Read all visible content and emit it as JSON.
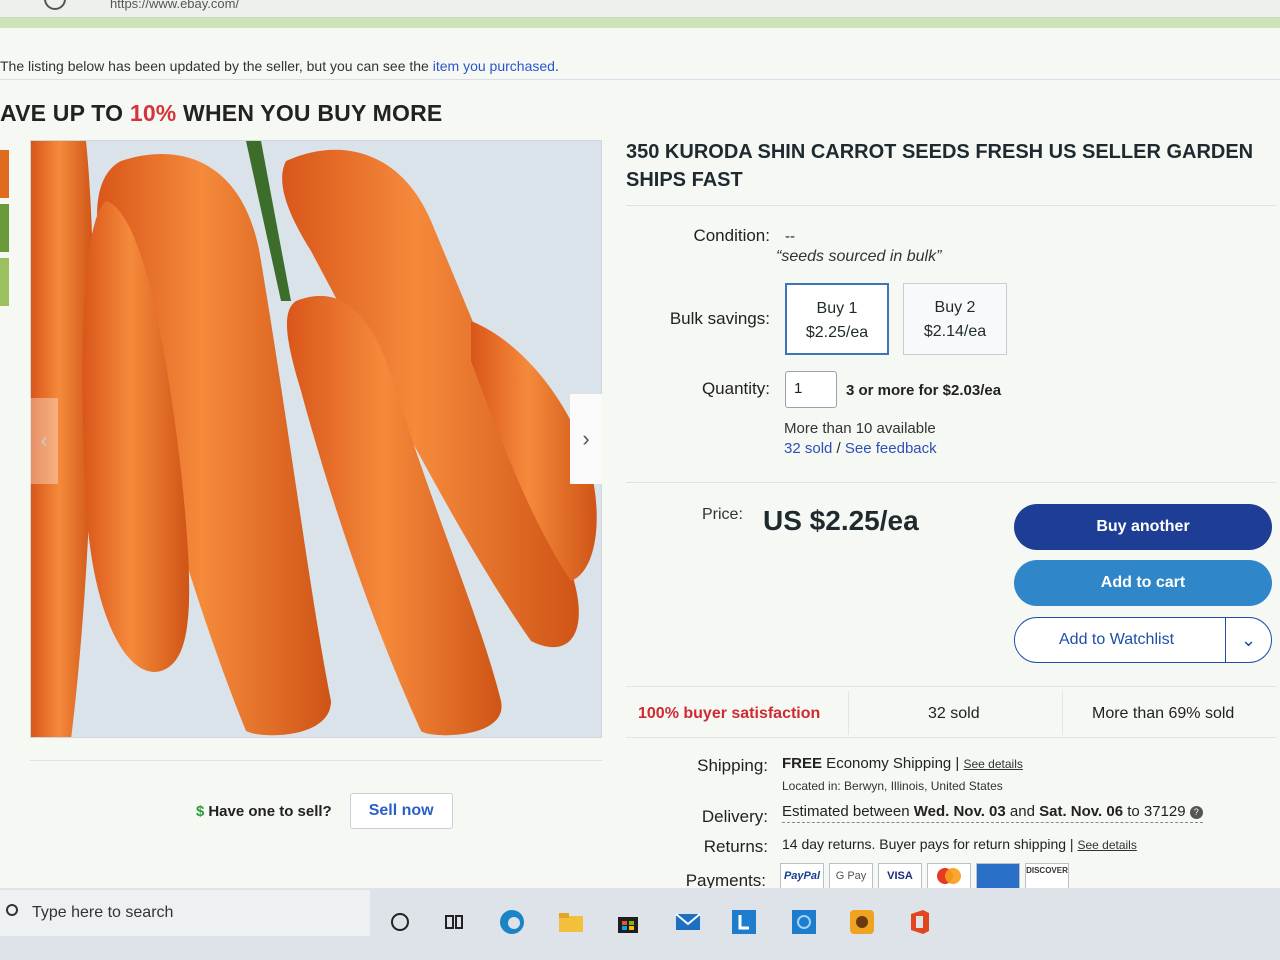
{
  "browser": {
    "url": "https://www.ebay.com/"
  },
  "notice": {
    "prefix": "The listing below has been updated by the seller, but you can see the ",
    "link": "item you purchased",
    "suffix": "."
  },
  "promo": {
    "lead": "AVE UP TO ",
    "pct": "10%",
    "tail": " WHEN YOU BUY MORE"
  },
  "sell": {
    "question": "Have one to sell?",
    "button": "Sell now",
    "dollar": "$"
  },
  "listing": {
    "title": "350 KURODA SHIN CARROT SEEDS FRESH US SELLER GARDEN SHIPS FAST",
    "condition_label": "Condition:",
    "condition_value": "--",
    "quote": "seeds sourced in bulk",
    "bulk_label": "Bulk savings:",
    "bulk": [
      {
        "qty": "Buy 1",
        "price": "$2.25/ea"
      },
      {
        "qty": "Buy 2",
        "price": "$2.14/ea"
      }
    ],
    "quantity_label": "Quantity:",
    "quantity_value": "1",
    "quantity_note": "3 or more for $2.03/ea",
    "available": "More than 10 available",
    "sold_link": "32 sold",
    "slash": " / ",
    "feedback_link": "See feedback",
    "price_label": "Price:",
    "price": "US $2.25/ea",
    "buy_another": "Buy another",
    "add_to_cart": "Add to cart",
    "add_to_watchlist": "Add to Watchlist",
    "stats": {
      "satisfaction": "100% buyer satisfaction",
      "sold": "32 sold",
      "percent_sold": "More than 69% sold"
    },
    "shipping_label": "Shipping:",
    "shipping_free": "FREE",
    "shipping_method": " Economy Shipping | ",
    "shipping_details": "See details",
    "location": "Located in: Berwyn, Illinois, United States",
    "delivery_label": "Delivery:",
    "delivery_prefix": "Estimated between ",
    "delivery_start": "Wed. Nov. 03",
    "delivery_and": " and ",
    "delivery_end": "Sat. Nov. 06",
    "delivery_to": " to 37129 ",
    "returns_label": "Returns:",
    "returns_text": "14 day returns. Buyer pays for return shipping | ",
    "returns_details": "See details",
    "payments_label": "Payments:",
    "payments": [
      "PayPal",
      "G Pay",
      "VISA",
      "Mastercard",
      "AMEX",
      "DISCOVER"
    ]
  },
  "taskbar": {
    "search_placeholder": "Type here to search"
  }
}
